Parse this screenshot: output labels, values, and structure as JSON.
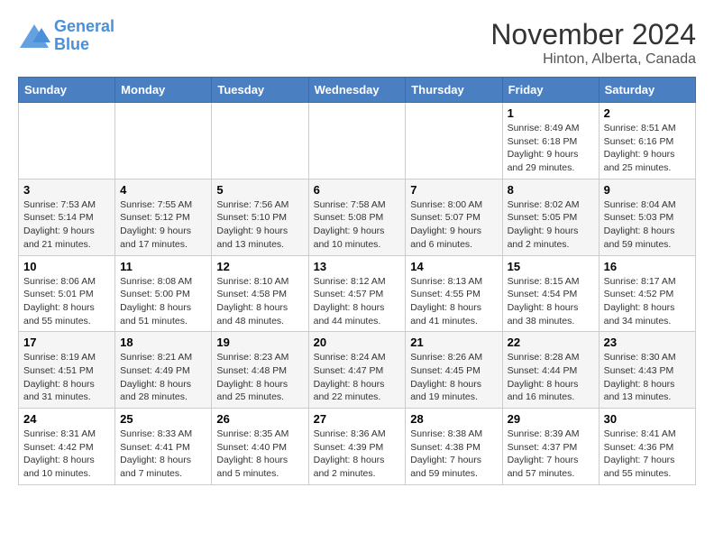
{
  "logo": {
    "line1": "General",
    "line2": "Blue"
  },
  "title": "November 2024",
  "subtitle": "Hinton, Alberta, Canada",
  "days_of_week": [
    "Sunday",
    "Monday",
    "Tuesday",
    "Wednesday",
    "Thursday",
    "Friday",
    "Saturday"
  ],
  "weeks": [
    [
      {
        "day": "",
        "sunrise": "",
        "sunset": "",
        "daylight": ""
      },
      {
        "day": "",
        "sunrise": "",
        "sunset": "",
        "daylight": ""
      },
      {
        "day": "",
        "sunrise": "",
        "sunset": "",
        "daylight": ""
      },
      {
        "day": "",
        "sunrise": "",
        "sunset": "",
        "daylight": ""
      },
      {
        "day": "",
        "sunrise": "",
        "sunset": "",
        "daylight": ""
      },
      {
        "day": "1",
        "sunrise": "Sunrise: 8:49 AM",
        "sunset": "Sunset: 6:18 PM",
        "daylight": "Daylight: 9 hours and 29 minutes."
      },
      {
        "day": "2",
        "sunrise": "Sunrise: 8:51 AM",
        "sunset": "Sunset: 6:16 PM",
        "daylight": "Daylight: 9 hours and 25 minutes."
      }
    ],
    [
      {
        "day": "3",
        "sunrise": "Sunrise: 7:53 AM",
        "sunset": "Sunset: 5:14 PM",
        "daylight": "Daylight: 9 hours and 21 minutes."
      },
      {
        "day": "4",
        "sunrise": "Sunrise: 7:55 AM",
        "sunset": "Sunset: 5:12 PM",
        "daylight": "Daylight: 9 hours and 17 minutes."
      },
      {
        "day": "5",
        "sunrise": "Sunrise: 7:56 AM",
        "sunset": "Sunset: 5:10 PM",
        "daylight": "Daylight: 9 hours and 13 minutes."
      },
      {
        "day": "6",
        "sunrise": "Sunrise: 7:58 AM",
        "sunset": "Sunset: 5:08 PM",
        "daylight": "Daylight: 9 hours and 10 minutes."
      },
      {
        "day": "7",
        "sunrise": "Sunrise: 8:00 AM",
        "sunset": "Sunset: 5:07 PM",
        "daylight": "Daylight: 9 hours and 6 minutes."
      },
      {
        "day": "8",
        "sunrise": "Sunrise: 8:02 AM",
        "sunset": "Sunset: 5:05 PM",
        "daylight": "Daylight: 9 hours and 2 minutes."
      },
      {
        "day": "9",
        "sunrise": "Sunrise: 8:04 AM",
        "sunset": "Sunset: 5:03 PM",
        "daylight": "Daylight: 8 hours and 59 minutes."
      }
    ],
    [
      {
        "day": "10",
        "sunrise": "Sunrise: 8:06 AM",
        "sunset": "Sunset: 5:01 PM",
        "daylight": "Daylight: 8 hours and 55 minutes."
      },
      {
        "day": "11",
        "sunrise": "Sunrise: 8:08 AM",
        "sunset": "Sunset: 5:00 PM",
        "daylight": "Daylight: 8 hours and 51 minutes."
      },
      {
        "day": "12",
        "sunrise": "Sunrise: 8:10 AM",
        "sunset": "Sunset: 4:58 PM",
        "daylight": "Daylight: 8 hours and 48 minutes."
      },
      {
        "day": "13",
        "sunrise": "Sunrise: 8:12 AM",
        "sunset": "Sunset: 4:57 PM",
        "daylight": "Daylight: 8 hours and 44 minutes."
      },
      {
        "day": "14",
        "sunrise": "Sunrise: 8:13 AM",
        "sunset": "Sunset: 4:55 PM",
        "daylight": "Daylight: 8 hours and 41 minutes."
      },
      {
        "day": "15",
        "sunrise": "Sunrise: 8:15 AM",
        "sunset": "Sunset: 4:54 PM",
        "daylight": "Daylight: 8 hours and 38 minutes."
      },
      {
        "day": "16",
        "sunrise": "Sunrise: 8:17 AM",
        "sunset": "Sunset: 4:52 PM",
        "daylight": "Daylight: 8 hours and 34 minutes."
      }
    ],
    [
      {
        "day": "17",
        "sunrise": "Sunrise: 8:19 AM",
        "sunset": "Sunset: 4:51 PM",
        "daylight": "Daylight: 8 hours and 31 minutes."
      },
      {
        "day": "18",
        "sunrise": "Sunrise: 8:21 AM",
        "sunset": "Sunset: 4:49 PM",
        "daylight": "Daylight: 8 hours and 28 minutes."
      },
      {
        "day": "19",
        "sunrise": "Sunrise: 8:23 AM",
        "sunset": "Sunset: 4:48 PM",
        "daylight": "Daylight: 8 hours and 25 minutes."
      },
      {
        "day": "20",
        "sunrise": "Sunrise: 8:24 AM",
        "sunset": "Sunset: 4:47 PM",
        "daylight": "Daylight: 8 hours and 22 minutes."
      },
      {
        "day": "21",
        "sunrise": "Sunrise: 8:26 AM",
        "sunset": "Sunset: 4:45 PM",
        "daylight": "Daylight: 8 hours and 19 minutes."
      },
      {
        "day": "22",
        "sunrise": "Sunrise: 8:28 AM",
        "sunset": "Sunset: 4:44 PM",
        "daylight": "Daylight: 8 hours and 16 minutes."
      },
      {
        "day": "23",
        "sunrise": "Sunrise: 8:30 AM",
        "sunset": "Sunset: 4:43 PM",
        "daylight": "Daylight: 8 hours and 13 minutes."
      }
    ],
    [
      {
        "day": "24",
        "sunrise": "Sunrise: 8:31 AM",
        "sunset": "Sunset: 4:42 PM",
        "daylight": "Daylight: 8 hours and 10 minutes."
      },
      {
        "day": "25",
        "sunrise": "Sunrise: 8:33 AM",
        "sunset": "Sunset: 4:41 PM",
        "daylight": "Daylight: 8 hours and 7 minutes."
      },
      {
        "day": "26",
        "sunrise": "Sunrise: 8:35 AM",
        "sunset": "Sunset: 4:40 PM",
        "daylight": "Daylight: 8 hours and 5 minutes."
      },
      {
        "day": "27",
        "sunrise": "Sunrise: 8:36 AM",
        "sunset": "Sunset: 4:39 PM",
        "daylight": "Daylight: 8 hours and 2 minutes."
      },
      {
        "day": "28",
        "sunrise": "Sunrise: 8:38 AM",
        "sunset": "Sunset: 4:38 PM",
        "daylight": "Daylight: 7 hours and 59 minutes."
      },
      {
        "day": "29",
        "sunrise": "Sunrise: 8:39 AM",
        "sunset": "Sunset: 4:37 PM",
        "daylight": "Daylight: 7 hours and 57 minutes."
      },
      {
        "day": "30",
        "sunrise": "Sunrise: 8:41 AM",
        "sunset": "Sunset: 4:36 PM",
        "daylight": "Daylight: 7 hours and 55 minutes."
      }
    ]
  ]
}
